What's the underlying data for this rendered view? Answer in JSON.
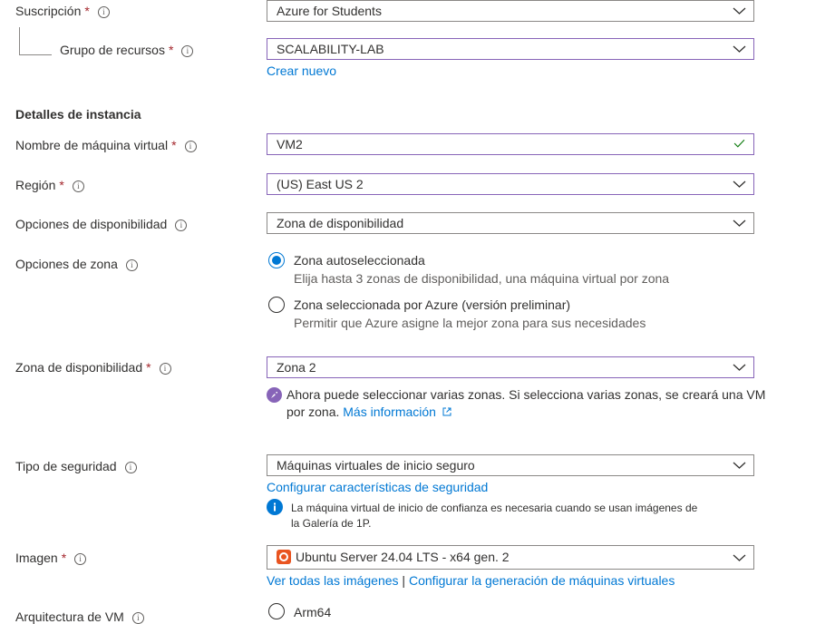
{
  "suscripcion": {
    "label": "Suscripción",
    "required": "*",
    "value": "Azure for Students"
  },
  "grupo": {
    "label": "Grupo de recursos",
    "required": "*",
    "value": "SCALABILITY-LAB",
    "create_link": "Crear nuevo"
  },
  "section_title": "Detalles de instancia",
  "nombre_vm": {
    "label": "Nombre de máquina virtual",
    "required": "*",
    "value": "VM2"
  },
  "region": {
    "label": "Región",
    "required": "*",
    "value": "(US) East US 2"
  },
  "disponibilidad": {
    "label": "Opciones de disponibilidad",
    "value": "Zona de disponibilidad"
  },
  "zona_opciones": {
    "label": "Opciones de zona",
    "options": [
      {
        "title": "Zona autoseleccionada",
        "desc": "Elija hasta 3 zonas de disponibilidad, una máquina virtual por zona",
        "selected": true
      },
      {
        "title": "Zona seleccionada por Azure (versión preliminar)",
        "desc": "Permitir que Azure asigne la mejor zona para sus necesidades",
        "selected": false
      }
    ]
  },
  "zona_disp": {
    "label": "Zona de disponibilidad",
    "required": "*",
    "value": "Zona 2",
    "message_line1": "Ahora puede seleccionar varias zonas. Si selecciona varias zonas, se creará una VM",
    "message_line2": "por zona.",
    "more_link": "Más información"
  },
  "seguridad": {
    "label": "Tipo de seguridad",
    "value": "Máquinas virtuales de inicio seguro",
    "config_link": "Configurar características de seguridad",
    "note_line1": "La máquina virtual de inicio de confianza es necesaria cuando se usan imágenes de",
    "note_line2": "la Galería de 1P."
  },
  "imagen": {
    "label": "Imagen",
    "required": "*",
    "value": "Ubuntu Server 24.04 LTS - x64 gen. 2",
    "link_all": "Ver todas las imágenes",
    "separator": "|",
    "link_config": "Configurar la generación de máquinas virtuales"
  },
  "arquitectura": {
    "label": "Arquitectura de VM",
    "option": "Arm64"
  },
  "info_glyph": "i",
  "icons": [
    "info-icon",
    "chevron-down-icon",
    "checkmark-icon",
    "rocket-icon",
    "external-link-icon",
    "ubuntu-logo-icon"
  ],
  "colors": {
    "accent": "#0078d4",
    "focus": "#8764b8",
    "required": "#a4262c",
    "success": "#107c10"
  }
}
